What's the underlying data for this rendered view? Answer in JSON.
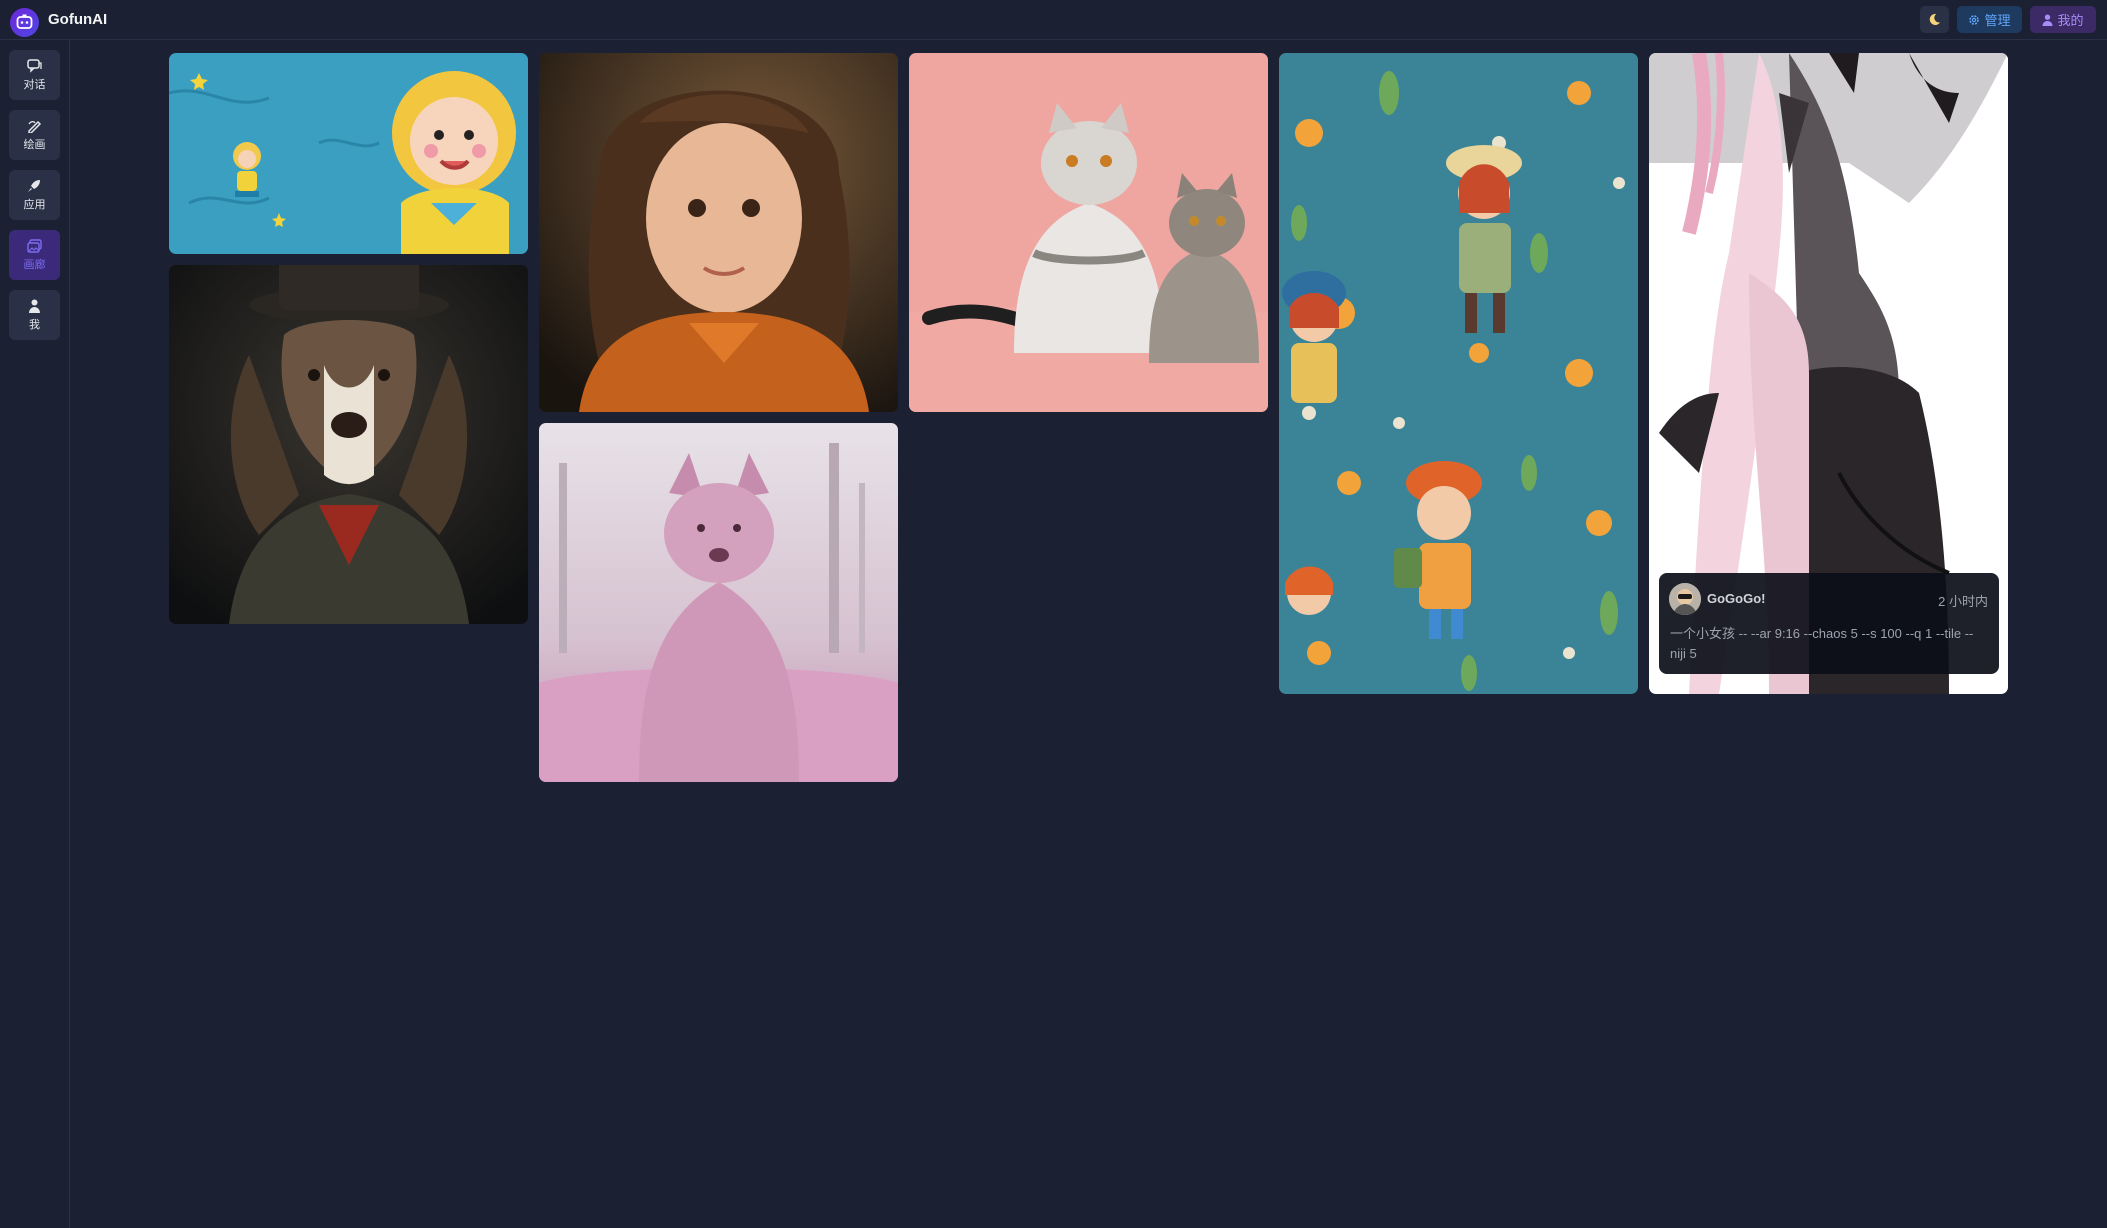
{
  "app": {
    "title": "GofunAI"
  },
  "header": {
    "admin_label": "管理",
    "mine_label": "我的"
  },
  "sidebar": {
    "items": [
      {
        "label": "对话",
        "icon": "chat-icon"
      },
      {
        "label": "绘画",
        "icon": "paint-icon"
      },
      {
        "label": "应用",
        "icon": "rocket-icon"
      },
      {
        "label": "画廊",
        "icon": "gallery-icon",
        "active": true
      },
      {
        "label": "我",
        "icon": "user-icon"
      }
    ]
  },
  "gallery": {
    "images": [
      {
        "subject": "curly-haired cartoon girl on blue background"
      },
      {
        "subject": "portrait of dog in top hat and coat"
      },
      {
        "subject": "smiling girl with long wavy hair"
      },
      {
        "subject": "pink furry dog in pink forest"
      },
      {
        "subject": "two cats on pink background"
      },
      {
        "subject": "illustrated pattern of girls with flowers"
      },
      {
        "subject": "anime girl in gothic black dress"
      }
    ],
    "hover_card": {
      "user": "GoGoGo!",
      "time": "2 小时内",
      "prompt": "一个小女孩 -- --ar 9:16 --chaos 5 --s 100 --q 1 --tile --niji 5"
    }
  },
  "colors": {
    "background": "#1b2032",
    "accent": "#6d28d9",
    "admin": "#60a5fa",
    "mine": "#a78bfa"
  }
}
